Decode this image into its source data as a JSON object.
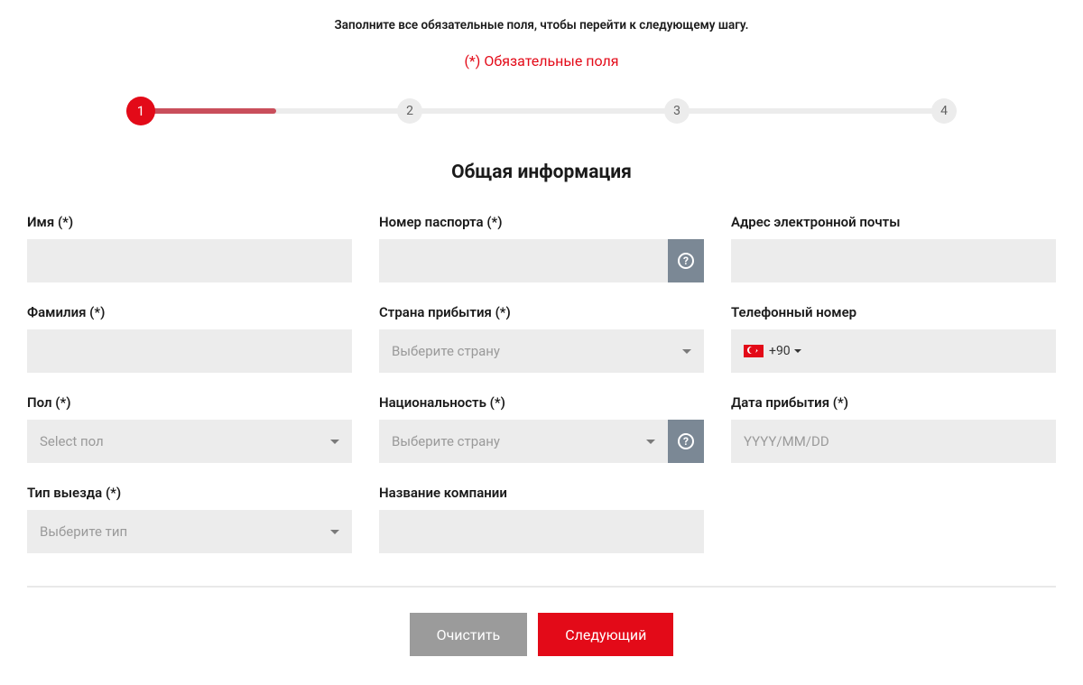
{
  "header": {
    "instruction": "Заполните все обязательные поля, чтобы перейти к следующему шагу.",
    "required_note": "(*) Обязательные поля"
  },
  "stepper": {
    "steps": [
      "1",
      "2",
      "3",
      "4"
    ],
    "active_index": 0
  },
  "section_title": "Общая информация",
  "fields": {
    "first_name": {
      "label": "Имя (*)"
    },
    "passport": {
      "label": "Номер паспорта (*)"
    },
    "email": {
      "label": "Адрес электронной почты"
    },
    "last_name": {
      "label": "Фамилия (*)"
    },
    "arrival_country": {
      "label": "Страна прибытия (*)",
      "placeholder": "Выберите страну"
    },
    "phone": {
      "label": "Телефонный номер",
      "prefix": "+90"
    },
    "gender": {
      "label": "Пол (*)",
      "placeholder": "Select пол"
    },
    "nationality": {
      "label": "Национальность (*)",
      "placeholder": "Выберите страну"
    },
    "arrival_date": {
      "label": "Дата прибытия (*)",
      "placeholder": "YYYY/MM/DD"
    },
    "departure_type": {
      "label": "Тип выезда (*)",
      "placeholder": "Выберите тип"
    },
    "company_name": {
      "label": "Название компании"
    }
  },
  "buttons": {
    "clear": "Очистить",
    "next": "Следующий"
  }
}
